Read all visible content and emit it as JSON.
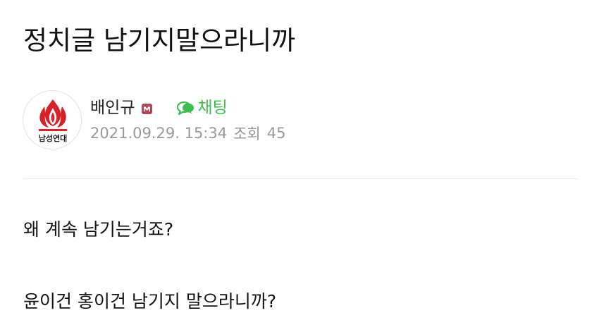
{
  "post": {
    "title": "정치글 남기지말으라니까"
  },
  "author": {
    "name": "배인규",
    "avatar_icon": "flame-logo-icon",
    "avatar_text": "남성연대",
    "grade_icon": "manager-badge-icon",
    "chat_label": "채팅",
    "chat_icon": "chat-bubble-icon"
  },
  "meta": {
    "date": "2021.09.29. 15:34",
    "views_label": "조회",
    "views_count": "45"
  },
  "content": {
    "lines": [
      "왜 계속 남기는거죠?",
      "윤이건 홍이건 남기지 말으라니까?"
    ]
  },
  "colors": {
    "chat_green": "#3fbd4f",
    "badge": "#b3475a",
    "flame_red": "#d8222a",
    "meta_gray": "#999999"
  }
}
